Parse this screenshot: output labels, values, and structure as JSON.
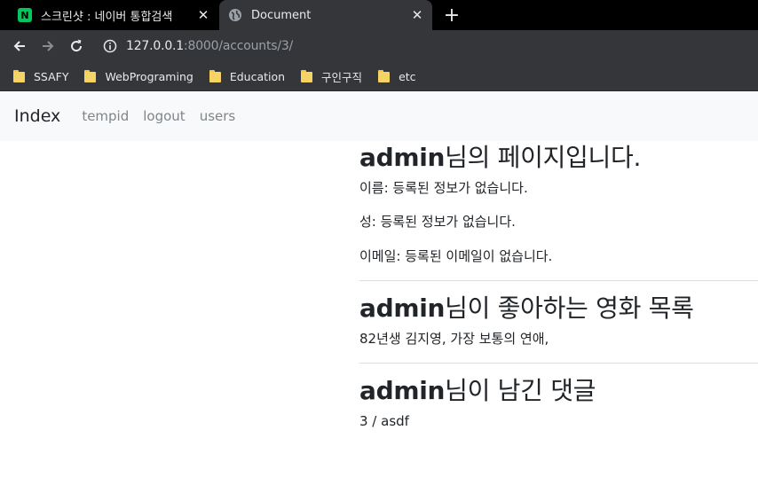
{
  "tabs": [
    {
      "title": "스크린샷 : 네이버 통합검색",
      "icon": "naver-icon",
      "favicon_letter": "N"
    },
    {
      "title": "Document",
      "icon": "globe-icon"
    }
  ],
  "toolbar": {
    "url_host": "127.0.0.1",
    "url_rest": ":8000/accounts/3/"
  },
  "bookmarks": [
    "SSAFY",
    "WebPrograming",
    "Education",
    "구인구직",
    "etc"
  ],
  "navbar": {
    "brand": "Index",
    "links": [
      "tempid",
      "logout",
      "users"
    ]
  },
  "profile": {
    "username": "admin",
    "page_title_suffix": "님의 페이지입니다.",
    "first_name_line": "이름: 등록된 정보가 없습니다.",
    "last_name_line": "성: 등록된 정보가 없습니다.",
    "email_line": "이메일: 등록된 이메일이 없습니다."
  },
  "liked_movies": {
    "heading_suffix": "님이 좋아하는 영화 목록",
    "items_text": "82년생 김지영, 가장 보통의 연애,"
  },
  "comments": {
    "heading_suffix": "님이 남긴 댓글",
    "items_text": "3 / asdf"
  },
  "colors": {
    "tabstrip": "#000000",
    "toolbar": "#35363a",
    "navbar_bg": "#f8f9fa",
    "nav_link": "#808589",
    "text": "#212529"
  }
}
